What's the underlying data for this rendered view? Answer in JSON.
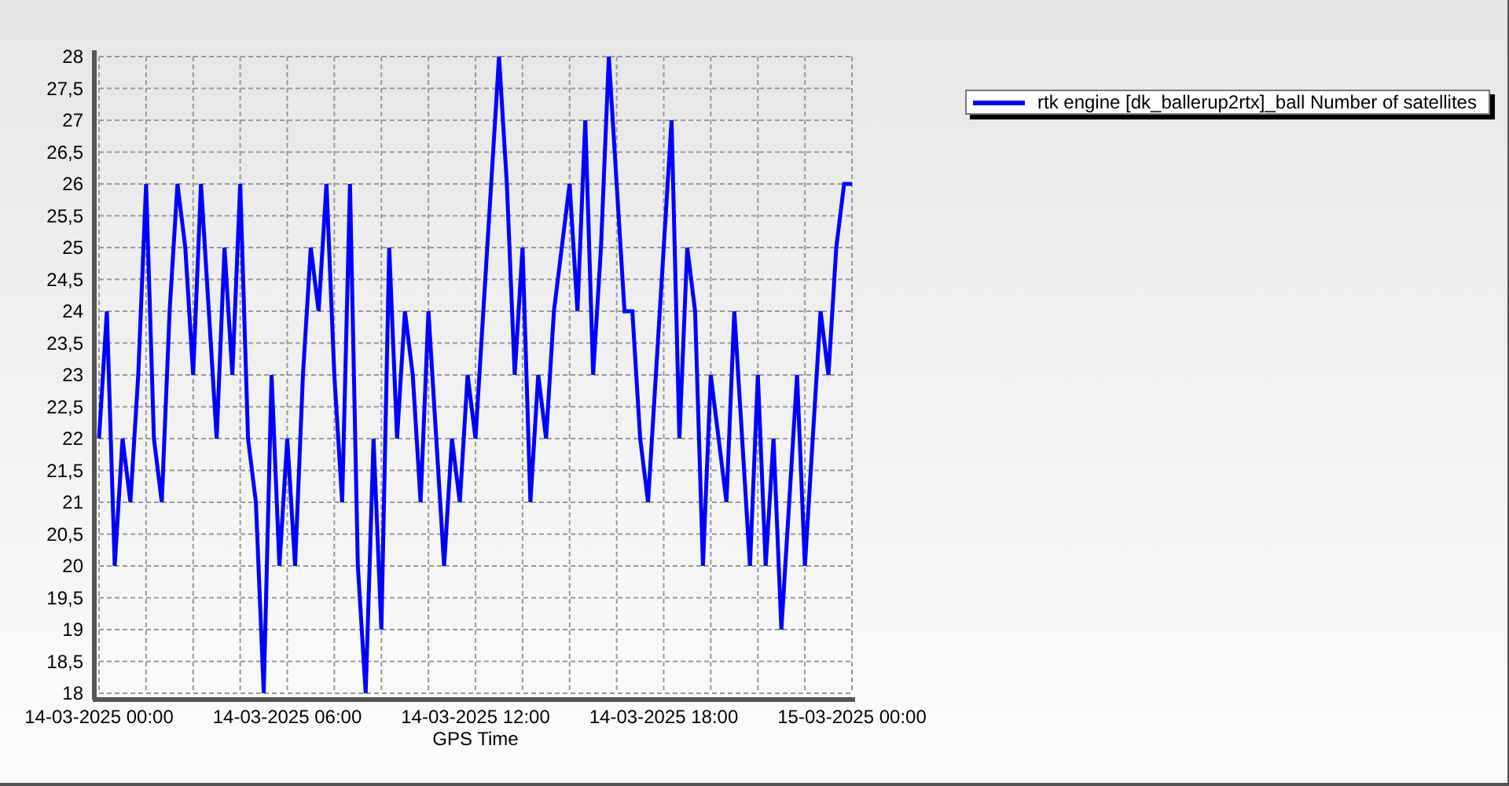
{
  "chart": {
    "chart_data": {
      "type": "line",
      "grid": true,
      "xlabel": "GPS Time",
      "ylim": [
        18,
        28
      ],
      "yticks": [
        {
          "value": 18,
          "label": "18"
        },
        {
          "value": 18.5,
          "label": "18,5"
        },
        {
          "value": 19,
          "label": "19"
        },
        {
          "value": 19.5,
          "label": "19,5"
        },
        {
          "value": 20,
          "label": "20"
        },
        {
          "value": 20.5,
          "label": "20,5"
        },
        {
          "value": 21,
          "label": "21"
        },
        {
          "value": 21.5,
          "label": "21,5"
        },
        {
          "value": 22,
          "label": "22"
        },
        {
          "value": 22.5,
          "label": "22,5"
        },
        {
          "value": 23,
          "label": "23"
        },
        {
          "value": 23.5,
          "label": "23,5"
        },
        {
          "value": 24,
          "label": "24"
        },
        {
          "value": 24.5,
          "label": "24,5"
        },
        {
          "value": 25,
          "label": "25"
        },
        {
          "value": 25.5,
          "label": "25,5"
        },
        {
          "value": 26,
          "label": "26"
        },
        {
          "value": 26.5,
          "label": "26,5"
        },
        {
          "value": 27,
          "label": "27"
        },
        {
          "value": 27.5,
          "label": "27,5"
        },
        {
          "value": 28,
          "label": "28"
        }
      ],
      "categories": [
        "14-03-2025 00:00",
        null,
        null,
        null,
        null,
        null,
        null,
        null,
        null,
        null,
        null,
        null,
        null,
        null,
        null,
        null,
        null,
        null,
        null,
        null,
        null,
        null,
        null,
        null,
        "14-03-2025 06:00",
        null,
        null,
        null,
        null,
        null,
        null,
        null,
        null,
        null,
        null,
        null,
        null,
        null,
        null,
        null,
        null,
        null,
        null,
        null,
        null,
        null,
        null,
        null,
        "14-03-2025 12:00",
        null,
        null,
        null,
        null,
        null,
        null,
        null,
        null,
        null,
        null,
        null,
        null,
        null,
        null,
        null,
        null,
        null,
        null,
        null,
        null,
        null,
        null,
        null,
        "14-03-2025 18:00",
        null,
        null,
        null,
        null,
        null,
        null,
        null,
        null,
        null,
        null,
        null,
        null,
        null,
        null,
        null,
        null,
        null,
        null,
        null,
        null,
        null,
        null,
        null,
        "15-03-2025 00:00"
      ],
      "series": [
        {
          "name": "rtk engine [dk_ballerup2rtx]_ball Number of satellites",
          "color": "#0000ff",
          "values": [
            22,
            24,
            20,
            22,
            21,
            23,
            26,
            22,
            21,
            24,
            26,
            25,
            23,
            26,
            24,
            22,
            25,
            23,
            26,
            22,
            21,
            18,
            23,
            20,
            22,
            20,
            23,
            25,
            24,
            26,
            23,
            21,
            26,
            20,
            18,
            22,
            19,
            25,
            22,
            24,
            23,
            21,
            24,
            22,
            20,
            22,
            21,
            23,
            22,
            24,
            26,
            28,
            26,
            23,
            25,
            21,
            23,
            22,
            24,
            25,
            26,
            24,
            27,
            23,
            25,
            28,
            26,
            24,
            24,
            22,
            21,
            23,
            25,
            27,
            22,
            25,
            24,
            20,
            23,
            22,
            21,
            24,
            22,
            20,
            23,
            20,
            22,
            19,
            21,
            23,
            20,
            22,
            24,
            23,
            25,
            26,
            26
          ]
        }
      ]
    }
  }
}
